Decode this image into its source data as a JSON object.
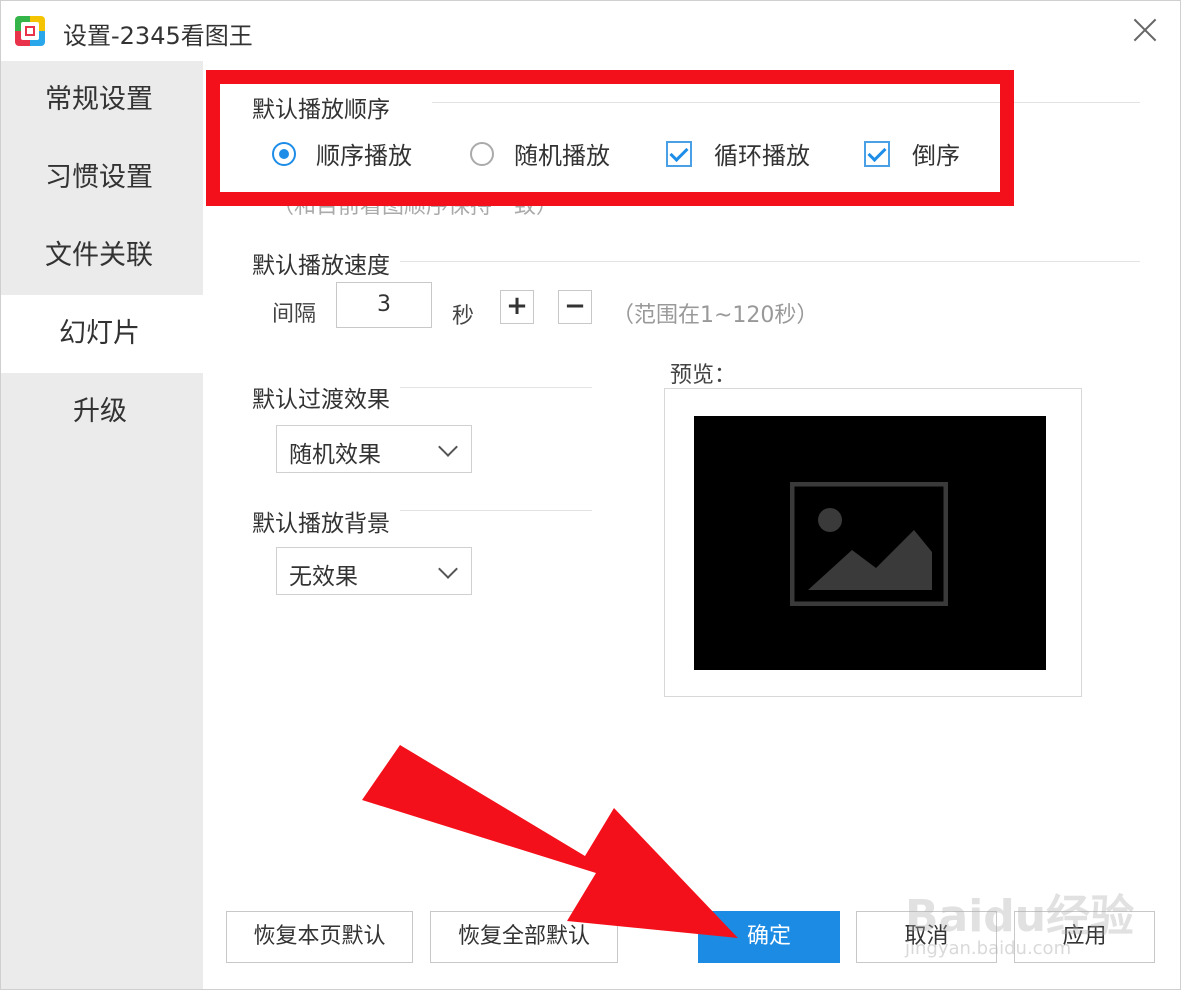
{
  "window": {
    "title": "设置-2345看图王"
  },
  "sidebar": {
    "items": [
      {
        "label": "常规设置"
      },
      {
        "label": "习惯设置"
      },
      {
        "label": "文件关联"
      },
      {
        "label": "幻灯片"
      },
      {
        "label": "升级"
      }
    ],
    "active_index": 3
  },
  "play_order": {
    "title": "默认播放顺序",
    "options": [
      {
        "label": "顺序播放",
        "type": "radio",
        "checked": true
      },
      {
        "label": "随机播放",
        "type": "radio",
        "checked": false
      },
      {
        "label": "循环播放",
        "type": "checkbox",
        "checked": true
      },
      {
        "label": "倒序",
        "type": "checkbox",
        "checked": true
      }
    ],
    "hint": "（和目前看图顺序保持一致）"
  },
  "play_speed": {
    "title": "默认播放速度",
    "interval_label": "间隔",
    "interval_value": "3",
    "unit": "秒",
    "plus": "+",
    "minus": "−",
    "range_hint": "（范围在1~120秒）"
  },
  "transition": {
    "title": "默认过渡效果",
    "selected": "随机效果"
  },
  "background": {
    "title": "默认播放背景",
    "selected": "无效果"
  },
  "preview": {
    "label": "预览："
  },
  "buttons": {
    "restore_page": "恢复本页默认",
    "restore_all": "恢复全部默认",
    "ok": "确定",
    "cancel": "取消",
    "apply": "应用"
  },
  "watermark": {
    "brand": "Baidu经验",
    "url": "jingyan.baidu.com"
  },
  "colors": {
    "accent": "#1b8be4",
    "highlight_red": "#f4101a"
  }
}
